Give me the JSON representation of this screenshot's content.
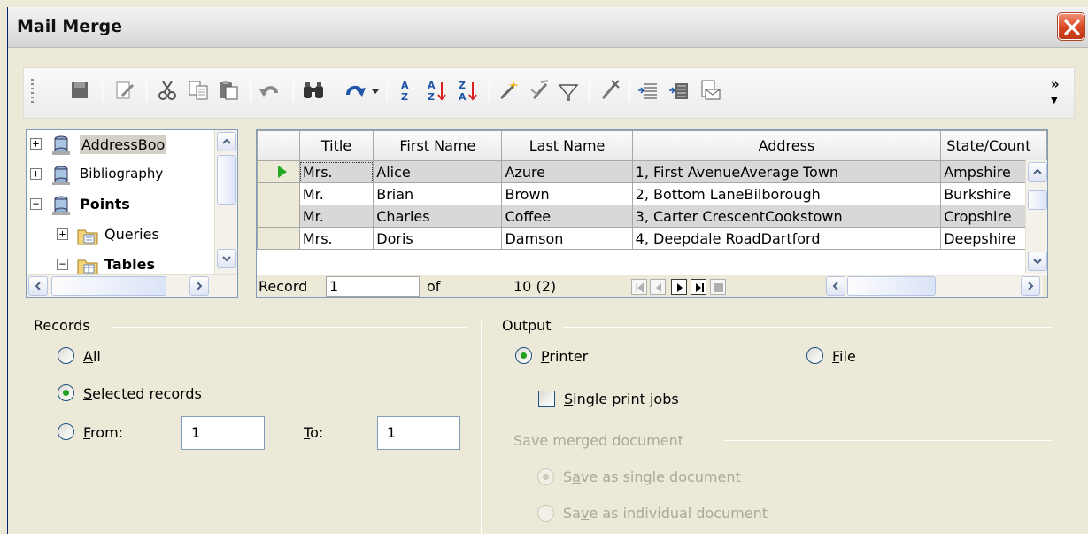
{
  "window": {
    "title": "Mail Merge"
  },
  "toolbar": {
    "icons": [
      "save-icon",
      "edit-data-icon",
      "cut-icon",
      "copy-icon",
      "paste-icon",
      "undo-icon",
      "find-icon",
      "redo-icon",
      "sort-ascending-icon",
      "sort-az-icon",
      "sort-za-icon",
      "autofilter-icon",
      "standard-filter-icon",
      "filter-icon",
      "remove-filter-icon",
      "data-to-text-icon",
      "data-to-fields-icon",
      "mail-merge-icon"
    ],
    "overflow": "»"
  },
  "tree": {
    "items": [
      {
        "label": "AddressBoo",
        "expander": "+",
        "bold": false,
        "selected": true
      },
      {
        "label": "Bibliography",
        "expander": "+",
        "bold": false,
        "selected": false
      },
      {
        "label": "Points",
        "expander": "−",
        "bold": true,
        "selected": false
      },
      {
        "label": "Queries",
        "expander": "+",
        "bold": false,
        "selected": false
      },
      {
        "label": "Tables",
        "expander": "−",
        "bold": true,
        "selected": false
      }
    ]
  },
  "grid": {
    "columns": [
      "Title",
      "First Name",
      "Last Name",
      "Address",
      "State/Count"
    ],
    "rows": [
      [
        "Mrs.",
        "Alice",
        "Azure",
        "1, First AvenueAverage Town",
        "Ampshire"
      ],
      [
        "Mr.",
        "Brian",
        "Brown",
        "2, Bottom LaneBilborough",
        "Burkshire"
      ],
      [
        "Mr.",
        "Charles",
        "Coffee",
        "3, Carter CrescentCookstown",
        "Cropshire"
      ],
      [
        "Mrs.",
        "Doris",
        "Damson",
        "4, Deepdale RoadDartford",
        "Deepshire"
      ]
    ],
    "nav": {
      "record_label": "Record",
      "record_value": "1",
      "of_label": "of",
      "count": "10 (2)"
    }
  },
  "records": {
    "title": "Records",
    "all": {
      "pre": "",
      "key": "A",
      "post": "ll"
    },
    "selected": {
      "pre": "",
      "key": "S",
      "post": "elected records"
    },
    "from": {
      "pre": "",
      "key": "F",
      "post": "rom:"
    },
    "from_value": "1",
    "to": {
      "pre": "",
      "key": "T",
      "post": "o:"
    },
    "to_value": "1",
    "selected_option": "selected"
  },
  "output": {
    "title": "Output",
    "printer": {
      "pre": "",
      "key": "P",
      "post": "rinter"
    },
    "file": {
      "pre": "",
      "key": "F",
      "post": "ile"
    },
    "single_jobs": {
      "pre": "",
      "key": "S",
      "post": "ingle print jobs"
    },
    "save_title": "Save merged document",
    "save_single": {
      "pre": "S",
      "key": "a",
      "post": "ve as single document"
    },
    "save_individual": {
      "pre": "Sa",
      "key": "v",
      "post": "e as individual document"
    },
    "selected_option": "printer"
  },
  "colors": {
    "accent_green": "#21a121",
    "selection": "#d8d8d8",
    "close_button": "#d84520"
  }
}
